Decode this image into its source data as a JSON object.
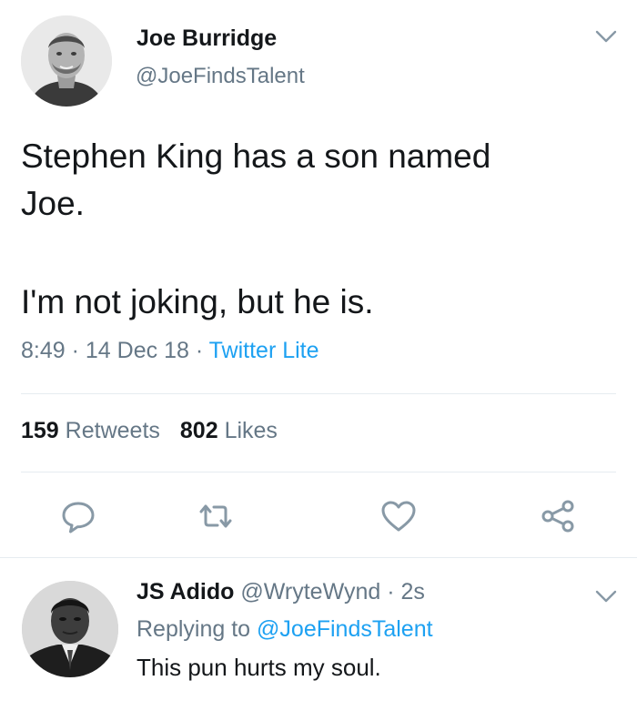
{
  "tweet": {
    "author": {
      "name": "Joe Burridge",
      "handle": "@JoeFindsTalent"
    },
    "text_lines": [
      "Stephen King has a son named",
      "Joe.",
      "I'm not joking, but he is."
    ],
    "time": "8:49",
    "date": "14 Dec 18",
    "separator": "·",
    "source": "Twitter Lite",
    "retweets_count": "159",
    "retweets_label": "Retweets",
    "likes_count": "802",
    "likes_label": "Likes"
  },
  "reply": {
    "name": "JS Adido",
    "handle": "@WryteWynd",
    "time": "· 2s",
    "replying_prefix": "Replying to",
    "replying_to": "@JoeFindsTalent",
    "text": "This pun hurts my soul."
  },
  "colors": {
    "accent": "#1da1f2",
    "muted": "#657786",
    "text": "#14171a",
    "icon": "#8899a6"
  },
  "icons": {
    "reply": "speech-bubble-icon",
    "retweet": "retweet-icon",
    "like": "heart-icon",
    "share": "share-icon",
    "caret": "chevron-down-icon"
  }
}
